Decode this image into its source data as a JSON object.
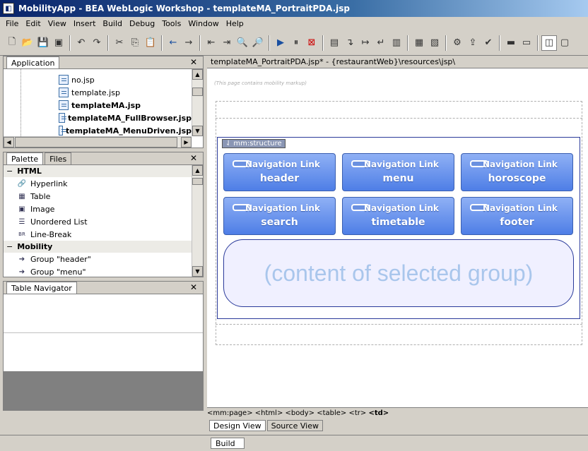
{
  "window": {
    "title": "MobilityApp - BEA WebLogic Workshop - templateMA_PortraitPDA.jsp"
  },
  "menu": [
    "File",
    "Edit",
    "View",
    "Insert",
    "Build",
    "Debug",
    "Tools",
    "Window",
    "Help"
  ],
  "application_panel": {
    "tab": "Application",
    "files": [
      {
        "name": "no.jsp",
        "bold": false
      },
      {
        "name": "template.jsp",
        "bold": false
      },
      {
        "name": "templateMA.jsp",
        "bold": true
      },
      {
        "name": "templateMA_FullBrowser.jsp",
        "bold": true
      },
      {
        "name": "templateMA_MenuDriven.jsp",
        "bold": true
      }
    ]
  },
  "palette_panel": {
    "tabs": [
      "Palette",
      "Files"
    ],
    "html_category": "HTML",
    "html_items": [
      "Hyperlink",
      "Table",
      "Image",
      "Unordered List",
      "Line-Break"
    ],
    "mobility_category": "Mobility",
    "mobility_items": [
      "Group \"header\"",
      "Group \"menu\""
    ]
  },
  "table_navigator": {
    "title": "Table Navigator"
  },
  "editor": {
    "path": "templateMA_PortraitPDA.jsp* - {restaurantWeb}\\resources\\jsp\\",
    "note": "(This page contains mobility markup)",
    "structure_label": "mm:structure",
    "nav_links": [
      {
        "line1": "Navigation Link",
        "line2": "header"
      },
      {
        "line1": "Navigation Link",
        "line2": "menu"
      },
      {
        "line1": "Navigation Link",
        "line2": "horoscope"
      },
      {
        "line1": "Navigation Link",
        "line2": "search"
      },
      {
        "line1": "Navigation Link",
        "line2": "timetable"
      },
      {
        "line1": "Navigation Link",
        "line2": "footer"
      }
    ],
    "content_text": "(content of selected group)",
    "tag_path": [
      "<mm:page>",
      "<html>",
      "<body>",
      "<table>",
      "<tr>",
      "<td>"
    ],
    "view_tabs": [
      "Design View",
      "Source View"
    ]
  },
  "bottom_tab": "Build"
}
